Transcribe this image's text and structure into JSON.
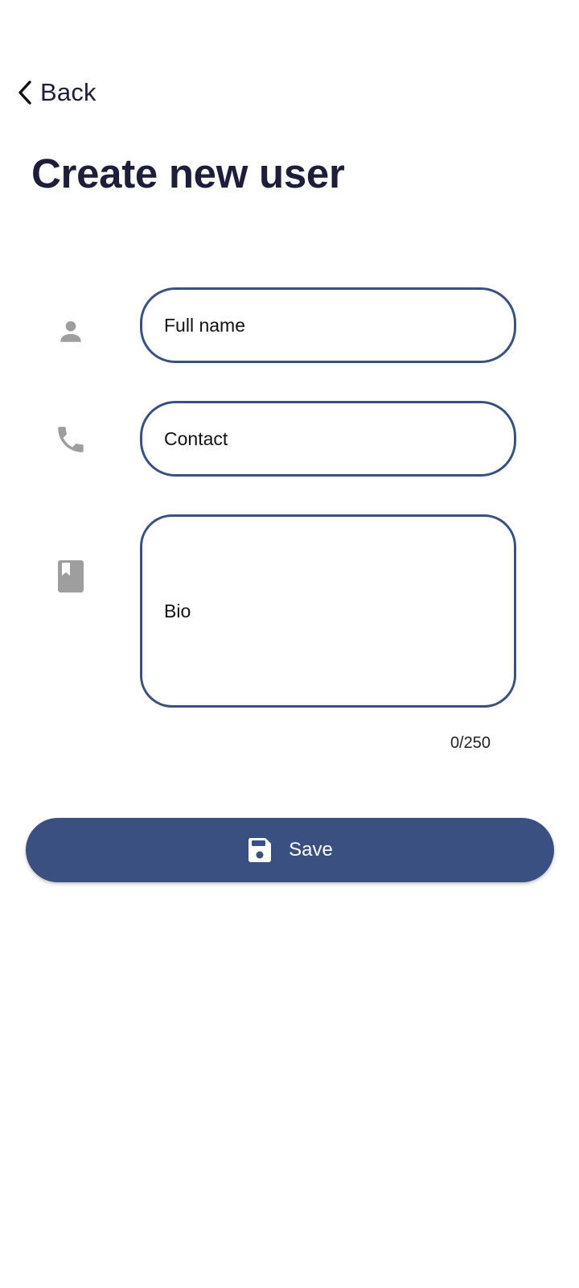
{
  "header": {
    "back_label": "Back",
    "title": "Create new user"
  },
  "form": {
    "full_name": {
      "placeholder": "Full name",
      "icon": "person-icon"
    },
    "contact": {
      "placeholder": "Contact",
      "icon": "phone-icon"
    },
    "bio": {
      "placeholder": "Bio",
      "icon": "book-icon",
      "counter": "0/250"
    }
  },
  "actions": {
    "save_label": "Save",
    "save_icon": "floppy-disk-icon"
  },
  "colors": {
    "primary": "#3a5080",
    "title_text": "#1d1f3a",
    "icon_gray": "#9e9e9e",
    "background": "#ffffff"
  }
}
